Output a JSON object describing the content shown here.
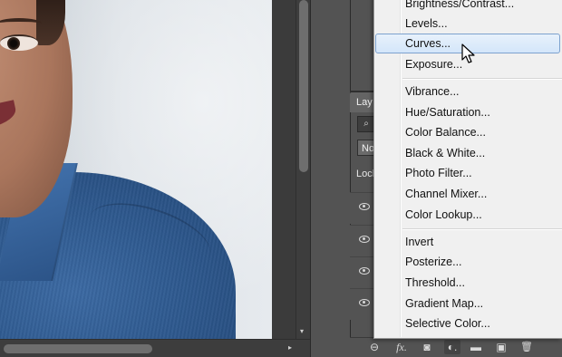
{
  "canvas": {
    "scroll_up_arrow": "▾",
    "scroll_right_arrow": "▸"
  },
  "layers_panel": {
    "tab_label": "Lay",
    "search_icon_glyph": "⌕",
    "blend_mode": "No",
    "lock_label": "Lock"
  },
  "adjustments_menu": {
    "items": [
      {
        "label": "Brightness/Contrast..."
      },
      {
        "label": "Levels..."
      },
      {
        "label": "Curves..."
      },
      {
        "label": "Exposure..."
      },
      {
        "label": "Vibrance..."
      },
      {
        "label": "Hue/Saturation..."
      },
      {
        "label": "Color Balance..."
      },
      {
        "label": "Black & White..."
      },
      {
        "label": "Photo Filter..."
      },
      {
        "label": "Channel Mixer..."
      },
      {
        "label": "Color Lookup..."
      },
      {
        "label": "Invert"
      },
      {
        "label": "Posterize..."
      },
      {
        "label": "Threshold..."
      },
      {
        "label": "Gradient Map..."
      },
      {
        "label": "Selective Color..."
      }
    ],
    "highlighted": "Curves..."
  },
  "footer": {
    "icons": [
      {
        "name": "link-icon",
        "glyph": "⊖"
      },
      {
        "name": "fx-icon",
        "glyph": "fx."
      },
      {
        "name": "mask-icon",
        "glyph": "◙"
      },
      {
        "name": "adjustment-layer-icon",
        "glyph": "◐."
      },
      {
        "name": "folder-icon",
        "glyph": "▬"
      },
      {
        "name": "new-layer-icon",
        "glyph": "▣"
      },
      {
        "name": "trash-icon",
        "glyph": "🗑"
      }
    ]
  },
  "colors": {
    "panel_bg": "#535353",
    "menu_bg": "#f0f0f0",
    "menu_highlight_border": "#7da2ce",
    "shirt_blue": "#2f5a90"
  }
}
